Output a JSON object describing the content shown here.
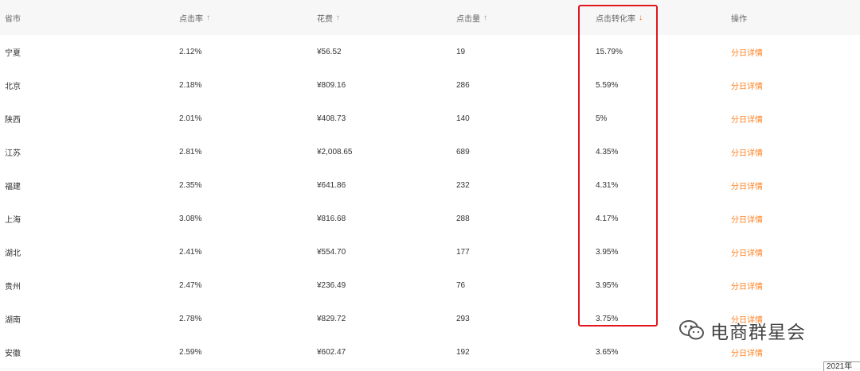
{
  "table": {
    "headers": {
      "province": "省市",
      "ctr": "点击率",
      "cost": "花费",
      "clicks": "点击量",
      "cvr": "点击转化率",
      "action": "操作"
    },
    "rows": [
      {
        "province": "宁夏",
        "ctr": "2.12%",
        "cost": "¥56.52",
        "clicks": "19",
        "cvr": "15.79%",
        "action": "分日详情"
      },
      {
        "province": "北京",
        "ctr": "2.18%",
        "cost": "¥809.16",
        "clicks": "286",
        "cvr": "5.59%",
        "action": "分日详情"
      },
      {
        "province": "陕西",
        "ctr": "2.01%",
        "cost": "¥408.73",
        "clicks": "140",
        "cvr": "5%",
        "action": "分日详情"
      },
      {
        "province": "江苏",
        "ctr": "2.81%",
        "cost": "¥2,008.65",
        "clicks": "689",
        "cvr": "4.35%",
        "action": "分日详情"
      },
      {
        "province": "福建",
        "ctr": "2.35%",
        "cost": "¥641.86",
        "clicks": "232",
        "cvr": "4.31%",
        "action": "分日详情"
      },
      {
        "province": "上海",
        "ctr": "3.08%",
        "cost": "¥816.68",
        "clicks": "288",
        "cvr": "4.17%",
        "action": "分日详情"
      },
      {
        "province": "湖北",
        "ctr": "2.41%",
        "cost": "¥554.70",
        "clicks": "177",
        "cvr": "3.95%",
        "action": "分日详情"
      },
      {
        "province": "贵州",
        "ctr": "2.47%",
        "cost": "¥236.49",
        "clicks": "76",
        "cvr": "3.95%",
        "action": "分日详情"
      },
      {
        "province": "湖南",
        "ctr": "2.78%",
        "cost": "¥829.72",
        "clicks": "293",
        "cvr": "3.75%",
        "action": "分日详情"
      },
      {
        "province": "安徽",
        "ctr": "2.59%",
        "cost": "¥602.47",
        "clicks": "192",
        "cvr": "3.65%",
        "action": "分日详情"
      }
    ]
  },
  "icons": {
    "sort_up": "↑",
    "sort_down": "↓"
  },
  "colors": {
    "link": "#ff7f1f",
    "sort_active": "#ff5a00",
    "highlight_border": "#e0171f"
  },
  "watermark": {
    "text": "电商群星会"
  },
  "date_tag": "2021年"
}
